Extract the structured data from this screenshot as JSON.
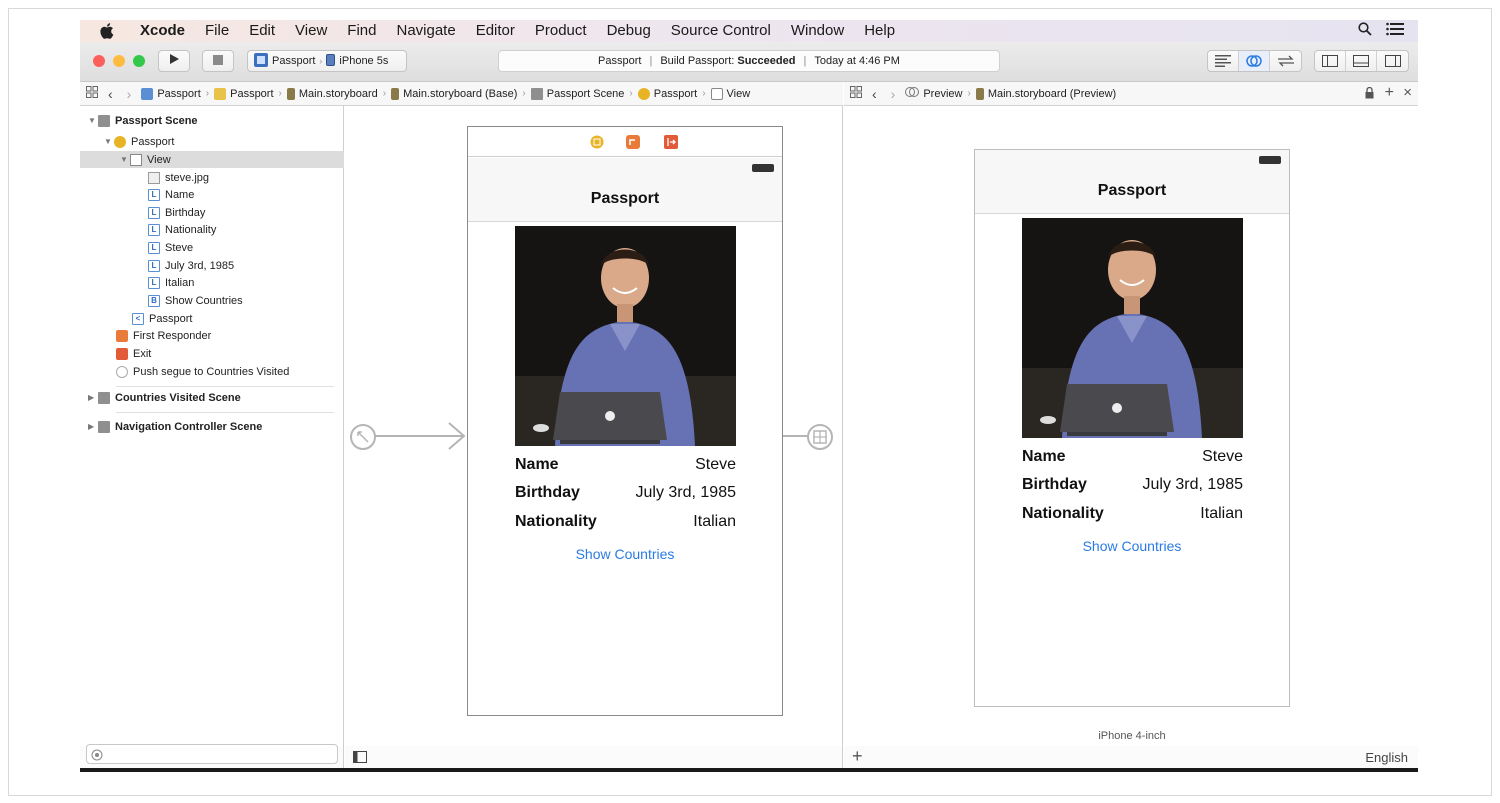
{
  "menubar": {
    "app": "Xcode",
    "items": [
      "File",
      "Edit",
      "View",
      "Find",
      "Navigate",
      "Editor",
      "Product",
      "Debug",
      "Source Control",
      "Window",
      "Help"
    ]
  },
  "toolbar": {
    "scheme": "Passport",
    "device": "iPhone 5s",
    "status_project": "Passport",
    "status_build_prefix": "Build Passport:",
    "status_build_result": "Succeeded",
    "status_time": "Today at 4:46 PM"
  },
  "jumpbar_left": {
    "crumbs": [
      "Passport",
      "Passport",
      "Main.storyboard",
      "Main.storyboard (Base)",
      "Passport Scene",
      "Passport",
      "View"
    ]
  },
  "jumpbar_right": {
    "crumbs": [
      "Preview",
      "Main.storyboard (Preview)"
    ]
  },
  "navigator": {
    "rows": [
      {
        "label": "Passport Scene",
        "bold": true
      },
      {
        "label": "Passport"
      },
      {
        "label": "View"
      },
      {
        "label": "steve.jpg"
      },
      {
        "label": "Name"
      },
      {
        "label": "Birthday"
      },
      {
        "label": "Nationality"
      },
      {
        "label": "Steve"
      },
      {
        "label": "July 3rd, 1985"
      },
      {
        "label": "Italian"
      },
      {
        "label": "Show Countries"
      },
      {
        "label": "Passport"
      },
      {
        "label": "First Responder"
      },
      {
        "label": "Exit"
      },
      {
        "label": "Push segue to Countries Visited"
      },
      {
        "label": "Countries Visited Scene",
        "bold": true
      },
      {
        "label": "Navigation Controller Scene",
        "bold": true
      }
    ],
    "icon_letters": {
      "label": "L",
      "button": "B",
      "back": "<"
    }
  },
  "storyboard": {
    "title": "Passport",
    "labels": {
      "name_key": "Name",
      "name_value": "Steve",
      "birthday_key": "Birthday",
      "birthday_value": "July 3rd, 1985",
      "nationality_key": "Nationality",
      "nationality_value": "Italian"
    },
    "button": "Show Countries"
  },
  "preview": {
    "title": "Passport",
    "labels": {
      "name_key": "Name",
      "name_value": "Steve",
      "birthday_key": "Birthday",
      "birthday_value": "July 3rd, 1985",
      "nationality_key": "Nationality",
      "nationality_value": "Italian"
    },
    "button": "Show Countries",
    "device_label": "iPhone 4-inch",
    "language": "English"
  },
  "colors": {
    "close": "#fc605b",
    "minimize": "#fdbc40",
    "zoom": "#34c84a",
    "link": "#2a7be4"
  }
}
